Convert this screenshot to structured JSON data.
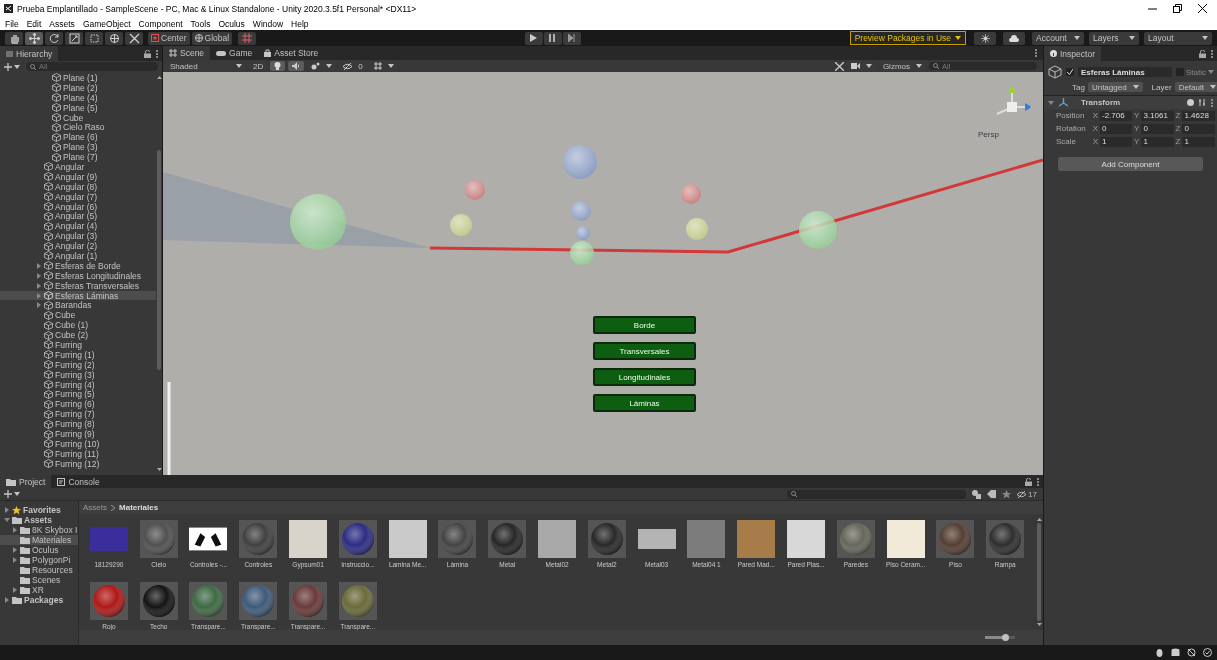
{
  "window": {
    "title": "Prueba Emplantillado - SampleScene - PC, Mac & Linux Standalone - Unity 2020.3.5f1 Personal* <DX11>"
  },
  "menu": [
    "File",
    "Edit",
    "Assets",
    "GameObject",
    "Component",
    "Tools",
    "Oculus",
    "Window",
    "Help"
  ],
  "toolbar": {
    "tools": [
      {
        "kind": "hand",
        "selected": false
      },
      {
        "kind": "move",
        "selected": true
      },
      {
        "kind": "rotate",
        "selected": false
      },
      {
        "kind": "scale",
        "selected": false
      },
      {
        "kind": "rect",
        "selected": false
      },
      {
        "kind": "transform",
        "selected": false
      },
      {
        "kind": "custom",
        "selected": false
      }
    ],
    "pivot": "Center",
    "space": "Global",
    "preview_packages": "Preview Packages in Use",
    "account": "Account",
    "layers": "Layers",
    "layout": "Layout"
  },
  "hierarchy": {
    "title": "Hierarchy",
    "search_placeholder": "All",
    "items": [
      {
        "children": [
          {
            "label": "Plane (1)",
            "selected": false
          },
          {
            "label": "Plane (2)",
            "selected": false
          },
          {
            "label": "Plane (4)",
            "selected": false
          },
          {
            "label": "Plane (5)",
            "selected": false
          },
          {
            "label": "Cube",
            "selected": false
          },
          {
            "label": "Cielo Raso",
            "selected": false
          },
          {
            "label": "Plane (6)",
            "selected": false
          },
          {
            "label": "Plane (3)",
            "selected": false
          },
          {
            "label": "Plane (7)",
            "selected": false
          }
        ]
      },
      {
        "label": "Angular",
        "selected": false
      },
      {
        "label": "Angular (9)",
        "selected": false
      },
      {
        "label": "Angular (8)",
        "selected": false
      },
      {
        "label": "Angular (7)",
        "selected": false
      },
      {
        "label": "Angular (6)",
        "selected": false
      },
      {
        "label": "Angular (5)",
        "selected": false
      },
      {
        "label": "Angular (4)",
        "selected": false
      },
      {
        "label": "Angular (3)",
        "selected": false
      },
      {
        "label": "Angular (2)",
        "selected": false
      },
      {
        "label": "Angular (1)",
        "selected": false
      },
      {
        "label": "Esferas de Borde",
        "selected": false,
        "kind": "group"
      },
      {
        "label": "Esferas Longitudinales",
        "selected": false,
        "kind": "group"
      },
      {
        "label": "Esferas Transversales",
        "selected": false,
        "kind": "group"
      },
      {
        "label": "Esferas Láminas",
        "selected": true,
        "kind": "group"
      },
      {
        "label": "Barandas",
        "selected": false,
        "kind": "group"
      },
      {
        "label": "Cube",
        "selected": false
      },
      {
        "label": "Cube (1)",
        "selected": false
      },
      {
        "label": "Cube (2)",
        "selected": false
      },
      {
        "label": "Furring",
        "selected": false
      },
      {
        "label": "Furring (1)",
        "selected": false
      },
      {
        "label": "Furring (2)",
        "selected": false
      },
      {
        "label": "Furring (3)",
        "selected": false
      },
      {
        "label": "Furring (4)",
        "selected": false
      },
      {
        "label": "Furring (5)",
        "selected": false
      },
      {
        "label": "Furring (6)",
        "selected": false
      },
      {
        "label": "Furring (7)",
        "selected": false
      },
      {
        "label": "Furring (8)",
        "selected": false
      },
      {
        "label": "Furring (9)",
        "selected": false
      },
      {
        "label": "Furring (10)",
        "selected": false
      },
      {
        "label": "Furring (11)",
        "selected": false
      },
      {
        "label": "Furring (12)",
        "selected": false
      }
    ]
  },
  "scene": {
    "tabs": [
      {
        "label": "Scene",
        "kind": "scene",
        "selected": true
      },
      {
        "label": "Game",
        "kind": "game",
        "selected": false
      },
      {
        "label": "Asset Store",
        "kind": "store",
        "selected": false
      }
    ],
    "shading": "Shaded",
    "mode_2d": "2D",
    "lighting_on": true,
    "audio_on": true,
    "hidden_count": "0",
    "gizmos": "Gizmos",
    "search_placeholder": "All",
    "view_label": "Persp",
    "game_buttons": [
      "Borde",
      "Transversales",
      "Longitudinales",
      "Láminas"
    ]
  },
  "inspector": {
    "title": "Inspector",
    "active": true,
    "object_name": "Esferas Láminas",
    "static_label": "Static",
    "tag_label": "Tag",
    "tag": "Untagged",
    "layer_label": "Layer",
    "layer": "Default",
    "component": "Transform",
    "rows": [
      {
        "label": "Position",
        "values": [
          {
            "axis": "X",
            "value": "-2.706"
          },
          {
            "axis": "Y",
            "value": "3.1061"
          },
          {
            "axis": "Z",
            "value": "1.4628"
          }
        ]
      },
      {
        "label": "Rotation",
        "values": [
          {
            "axis": "X",
            "value": "0"
          },
          {
            "axis": "Y",
            "value": "0"
          },
          {
            "axis": "Z",
            "value": "0"
          }
        ]
      },
      {
        "label": "Scale",
        "values": [
          {
            "axis": "X",
            "value": "1"
          },
          {
            "axis": "Y",
            "value": "1"
          },
          {
            "axis": "Z",
            "value": "1"
          }
        ]
      }
    ],
    "add_component": "Add Component"
  },
  "project": {
    "tabs": [
      {
        "label": "Project",
        "kind": "project",
        "selected": true
      },
      {
        "label": "Console",
        "kind": "console",
        "selected": false
      }
    ],
    "hidden_count": "17",
    "tree": [
      {
        "label": "Favorites",
        "kind": "favorites",
        "expanded": false,
        "selected": false
      },
      {
        "label": "Assets",
        "kind": "root",
        "expanded": true,
        "selected": false,
        "children": [
          {
            "label": "8K Skybox I",
            "kind": "branch",
            "expanded": false,
            "selected": false
          },
          {
            "label": "Materiales",
            "kind": "leaf",
            "selected": true
          },
          {
            "label": "Oculus",
            "kind": "branch",
            "expanded": false,
            "selected": false
          },
          {
            "label": "PolygonPi",
            "kind": "branch",
            "expanded": false,
            "selected": false
          },
          {
            "label": "Resources",
            "kind": "leaf",
            "selected": false
          },
          {
            "label": "Scenes",
            "kind": "leaf",
            "selected": false
          },
          {
            "label": "XR",
            "kind": "branch",
            "expanded": false,
            "selected": false
          }
        ]
      },
      {
        "label": "Packages",
        "kind": "root",
        "expanded": false,
        "selected": false
      }
    ],
    "breadcrumb": [
      "Assets",
      "Materiales"
    ],
    "assets": [
      {
        "name": "18129290",
        "kind": "image",
        "color": "#3a2f9a"
      },
      {
        "name": "Cielo",
        "kind": "sphere",
        "color": "#505050"
      },
      {
        "name": "Controles -...",
        "kind": "controllers",
        "color": "#ffffff"
      },
      {
        "name": "Controles",
        "kind": "sphere",
        "color": "#404040"
      },
      {
        "name": "Gypsum01",
        "kind": "texture",
        "color": "#d8d4cc"
      },
      {
        "name": "Instruccio...",
        "kind": "sphere",
        "color": "#2c2c84"
      },
      {
        "name": "Lamina Me...",
        "kind": "texture",
        "color": "#cacaca"
      },
      {
        "name": "Lámina",
        "kind": "sphere",
        "color": "#444444"
      },
      {
        "name": "Metal",
        "kind": "sphere",
        "color": "#262626"
      },
      {
        "name": "Metal02",
        "kind": "texture",
        "color": "#a8a8a8"
      },
      {
        "name": "Metal2",
        "kind": "sphere",
        "color": "#282828"
      },
      {
        "name": "Metal03",
        "kind": "strip",
        "color": "#b4b4b4"
      },
      {
        "name": "Metal04 1",
        "kind": "texture",
        "color": "#7c7c7c"
      },
      {
        "name": "Pared Mad...",
        "kind": "texture",
        "color": "#a87c48"
      },
      {
        "name": "Pared Plas...",
        "kind": "texture",
        "color": "#d8d8d8"
      },
      {
        "name": "Paredes",
        "kind": "sphere",
        "color": "#66665c"
      },
      {
        "name": "Piso Ceram...",
        "kind": "texture",
        "color": "#f2ead8"
      },
      {
        "name": "Piso",
        "kind": "sphere",
        "color": "#553e32"
      },
      {
        "name": "Rampa",
        "kind": "sphere",
        "color": "#2e2e2e"
      },
      {
        "name": "Rojo",
        "kind": "sphere",
        "color": "#b01818"
      },
      {
        "name": "Techo",
        "kind": "sphere",
        "color": "#141414"
      },
      {
        "name": "Transpare...",
        "kind": "sphere",
        "color": "#3f6a44"
      },
      {
        "name": "Transpare...",
        "kind": "sphere",
        "color": "#3f5a7a"
      },
      {
        "name": "Transpare...",
        "kind": "sphere",
        "color": "#6a3a3a"
      },
      {
        "name": "Transpare...",
        "kind": "sphere",
        "color": "#6a6a3a"
      }
    ],
    "zoom": {
      "level": 0.65
    }
  }
}
